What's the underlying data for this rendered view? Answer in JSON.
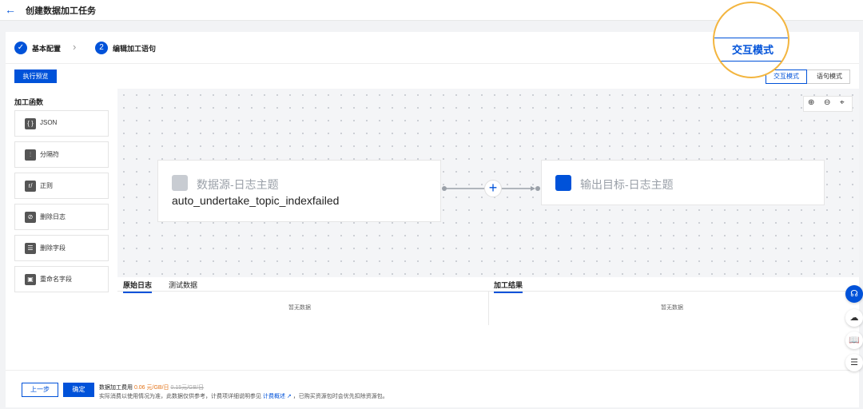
{
  "header": {
    "back_icon": "←",
    "title": "创建数据加工任务"
  },
  "steps": [
    {
      "num": "✓",
      "label": "基本配置"
    },
    {
      "num": "2",
      "label": "编辑加工语句"
    }
  ],
  "toolbar": {
    "run_preview": "执行预览"
  },
  "mode_tabs": {
    "interactive": "交互模式",
    "statement": "语句模式",
    "lens_label": "交互模式"
  },
  "sidebar": {
    "title": "加工函数",
    "items": [
      {
        "icon": "{ }",
        "label": "JSON"
      },
      {
        "icon": "⫶",
        "label": "分隔符"
      },
      {
        "icon": "r/",
        "label": "正则"
      },
      {
        "icon": "⊘",
        "label": "删除日志"
      },
      {
        "icon": "☰",
        "label": "删除字段"
      },
      {
        "icon": "▣",
        "label": "重命名字段"
      }
    ]
  },
  "canvas": {
    "zoom_in_icon": "⊕",
    "zoom_out_icon": "⊖",
    "locate_icon": "⌖",
    "source_node": {
      "title": "数据源-日志主题",
      "subtitle": "auto_undertake_topic_indexfailed"
    },
    "plus_icon": "+",
    "target_node": {
      "title": "输出目标-日志主题"
    }
  },
  "results": {
    "tabs": [
      "原始日志",
      "测试数据"
    ],
    "right_tab": "加工结果",
    "empty_left": "暂无数据",
    "empty_right": "暂无数据"
  },
  "footer": {
    "prev": "上一步",
    "confirm": "确定",
    "fee_label": "数据加工费用",
    "fee_price": "0.06 元/GB/日",
    "fee_original": "0.15元/GB/日",
    "note_prefix": "实际消费以使用情况为准，此数据仅供参考，计费项详细说明参见",
    "note_link": "计费概述",
    "note_suffix": "，已购买资源包时会优先扣除资源包。"
  },
  "float_icons": [
    "headset-icon",
    "cloud-icon",
    "book-icon",
    "list-icon"
  ],
  "colors": {
    "brand": "#0052d9",
    "highlight": "#f3b53f",
    "price": "#e37318"
  }
}
